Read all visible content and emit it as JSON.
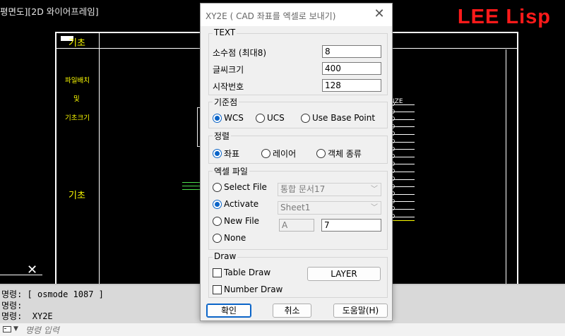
{
  "cad": {
    "view_title": "평면도][2D 와이어프레임]",
    "brand": "LEE Lisp",
    "label_kicho_top": "기초",
    "label_pile": "파일배치",
    "label_and": "및",
    "label_size": "기초크기",
    "label_kicho_bottom": "기초",
    "table_header": "IZE"
  },
  "command": {
    "history": [
      "명령: [ osmode 1087 ]",
      "명령:",
      "명령:  XY2E"
    ],
    "placeholder": "명령 입력"
  },
  "dialog": {
    "title": "XY2E ( CAD 좌표를 엑셀로 보내기)",
    "close_glyph": "✕",
    "text_group": {
      "label": "TEXT",
      "decimal_label": "소수점 (최대8)",
      "decimal_value": "8",
      "font_size_label": "글씨크기",
      "font_size_value": "400",
      "start_number_label": "시작번호",
      "start_number_value": "128"
    },
    "base_group": {
      "label": "기준점",
      "options": [
        "WCS",
        "UCS",
        "Use Base Point"
      ],
      "selected": "WCS"
    },
    "sort_group": {
      "label": "정렬",
      "options": [
        "좌표",
        "레이어",
        "객체 종류"
      ],
      "selected": "좌표"
    },
    "excel_group": {
      "label": "엑셀 파일",
      "select_file_label": "Select File",
      "select_file_value": "통합 문서17",
      "activate_label": "Activate",
      "activate_value": "Sheet1",
      "new_file_label": "New File",
      "new_file_col": "A",
      "new_file_row": "7",
      "none_label": "None",
      "selected": "Activate"
    },
    "draw_group": {
      "label": "Draw",
      "table_draw_label": "Table Draw",
      "table_draw_checked": false,
      "number_draw_label": "Number Draw",
      "number_draw_checked": false,
      "layer_button": "LAYER"
    },
    "buttons": {
      "ok": "확인",
      "cancel": "취소",
      "help": "도움말(H)"
    }
  },
  "colors": {
    "cad_background": "#000000",
    "brand": "#ff1a1a",
    "layer_yellow": "#ffff00",
    "accent": "#0a64c8"
  }
}
